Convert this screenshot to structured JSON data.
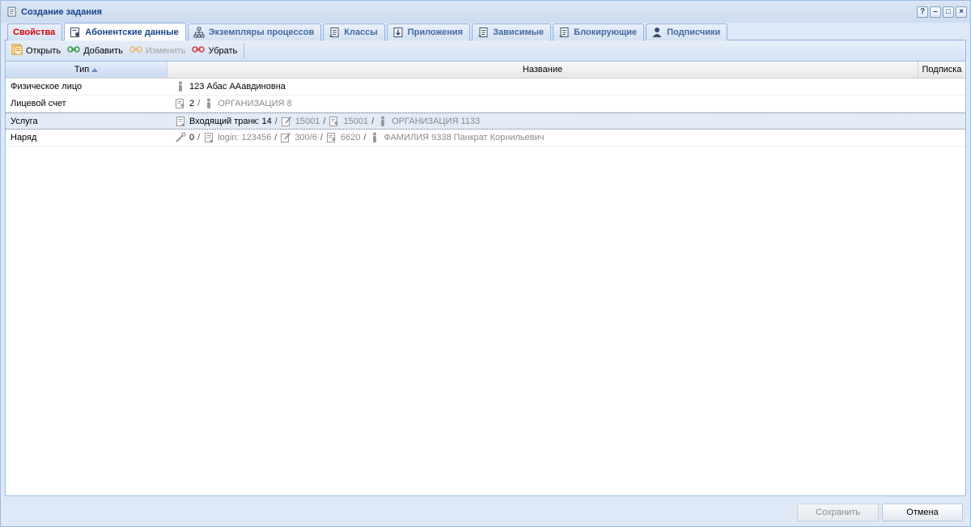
{
  "window": {
    "title": "Создание задания"
  },
  "title_tools": [
    "?",
    "–",
    "□",
    "×"
  ],
  "tabs": [
    {
      "label": "Свойства",
      "icon": "none",
      "active": false,
      "red": true
    },
    {
      "label": "Абонентские данные",
      "icon": "subscriber-card-icon",
      "active": true
    },
    {
      "label": "Экземпляры процессов",
      "icon": "process-tree-icon",
      "active": false
    },
    {
      "label": "Классы",
      "icon": "scroll-icon",
      "active": false
    },
    {
      "label": "Приложения",
      "icon": "download-icon",
      "active": false
    },
    {
      "label": "Зависимые",
      "icon": "scroll-icon",
      "active": false
    },
    {
      "label": "Блокирующие",
      "icon": "scroll-icon",
      "active": false
    },
    {
      "label": "Подписчики",
      "icon": "person-icon",
      "active": false
    }
  ],
  "toolbar": {
    "open_label": "Открыть",
    "add_label": "Добавить",
    "edit_label": "Изменить",
    "remove_label": "Убрать"
  },
  "grid": {
    "columns": {
      "type": "Тип",
      "name": "Название",
      "subscription": "Подписка"
    },
    "rows": [
      {
        "type": "Физическое лицо",
        "segments": [
          {
            "icon": "person-icon",
            "text": "123 Абас ААавдиновна",
            "grey": false
          }
        ]
      },
      {
        "type": "Лицевой счет",
        "segments": [
          {
            "icon": "account-document-icon",
            "text": "2",
            "grey": false
          },
          {
            "icon": "person-icon",
            "text": "ОРГАНИЗАЦИЯ 8",
            "grey": true
          }
        ]
      },
      {
        "type": "Услуга",
        "selected": true,
        "segments": [
          {
            "icon": "service-document-icon",
            "text": "Входящий транк: 14",
            "grey": false
          },
          {
            "icon": "edit-document-icon",
            "text": "15001",
            "grey": true
          },
          {
            "icon": "account-document-icon",
            "text": "15001",
            "grey": true
          },
          {
            "icon": "person-icon",
            "text": "ОРГАНИЗАЦИЯ 1133",
            "grey": true
          }
        ]
      },
      {
        "type": "Наряд",
        "segments": [
          {
            "icon": "wrench-icon",
            "text": "0",
            "grey": false
          },
          {
            "icon": "service-document-icon",
            "text": "login: 123456",
            "grey": true
          },
          {
            "icon": "edit-document-icon",
            "text": "300/6",
            "grey": true
          },
          {
            "icon": "account-document-icon",
            "text": "6620",
            "grey": true
          },
          {
            "icon": "person-icon",
            "text": "ФАМИЛИЯ 9338 Панкрат Корнильевич",
            "grey": true
          }
        ]
      }
    ]
  },
  "footer": {
    "save_label": "Сохранить",
    "cancel_label": "Отмена"
  },
  "colors": {
    "title_text": "#15428b",
    "red_tab": "#d40000",
    "border": "#99bbe8",
    "selection": "#e3ebf6"
  }
}
